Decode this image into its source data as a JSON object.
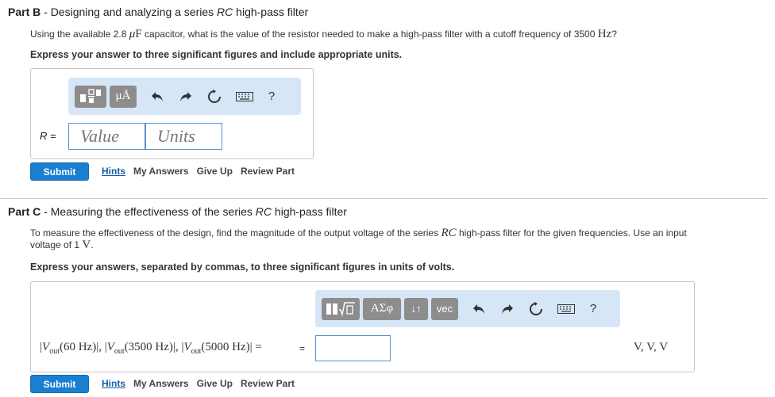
{
  "partB": {
    "title_prefix": "Part B",
    "title_sep": " - ",
    "title_text_1": "Designing and analyzing a series ",
    "title_rc": "RC",
    "title_text_2": " high-pass filter",
    "question_1": "Using the available 2.8 ",
    "question_unit_mu": "μ",
    "question_unit_f": "F",
    "question_2": " capacitor, what is the value of the resistor needed to make a high-pass filter with a cutoff frequency of 3500 ",
    "question_hz": "Hz",
    "question_3": "?",
    "instruction": "Express your answer to three significant figures and include appropriate units.",
    "toolbar": {
      "units_label": "μÅ",
      "help_label": "?"
    },
    "answer_label": "R =",
    "value_placeholder": "Value",
    "units_placeholder": "Units",
    "submit_label": "Submit",
    "links": {
      "hints": "Hints",
      "my_answers": "My Answers",
      "give_up": "Give Up",
      "review_part": "Review Part"
    }
  },
  "partC": {
    "title_prefix": "Part C",
    "title_sep": " - ",
    "title_text_1": "Measuring the effectiveness of the series ",
    "title_rc": "RC",
    "title_text_2": " high-pass filter",
    "question_1": "To measure the effectiveness of the design, find the magnitude of the output voltage of the series ",
    "question_rc": "RC",
    "question_2": " high-pass filter for the given frequencies. Use an input",
    "question_line2_1": "voltage of 1 ",
    "question_v": "V",
    "question_line2_2": ".",
    "instruction": "Express your answers, separated by commas, to three significant figures in units of volts.",
    "toolbar": {
      "greek_label": "ΑΣφ",
      "sort_label": "↓↑",
      "vec_label": "vec",
      "help_label": "?"
    },
    "expression": {
      "bar": "|",
      "v": "V",
      "sub": "out",
      "f1": "(60 Hz)",
      "f2": "(3500 Hz)",
      "f3": "(5000 Hz)",
      "comma": ", ",
      "eq": " = "
    },
    "answer_eq_sign": "=",
    "units_suffix": "V, V, V",
    "submit_label": "Submit",
    "links": {
      "hints": "Hints",
      "my_answers": "My Answers",
      "give_up": "Give Up",
      "review_part": "Review Part"
    }
  }
}
